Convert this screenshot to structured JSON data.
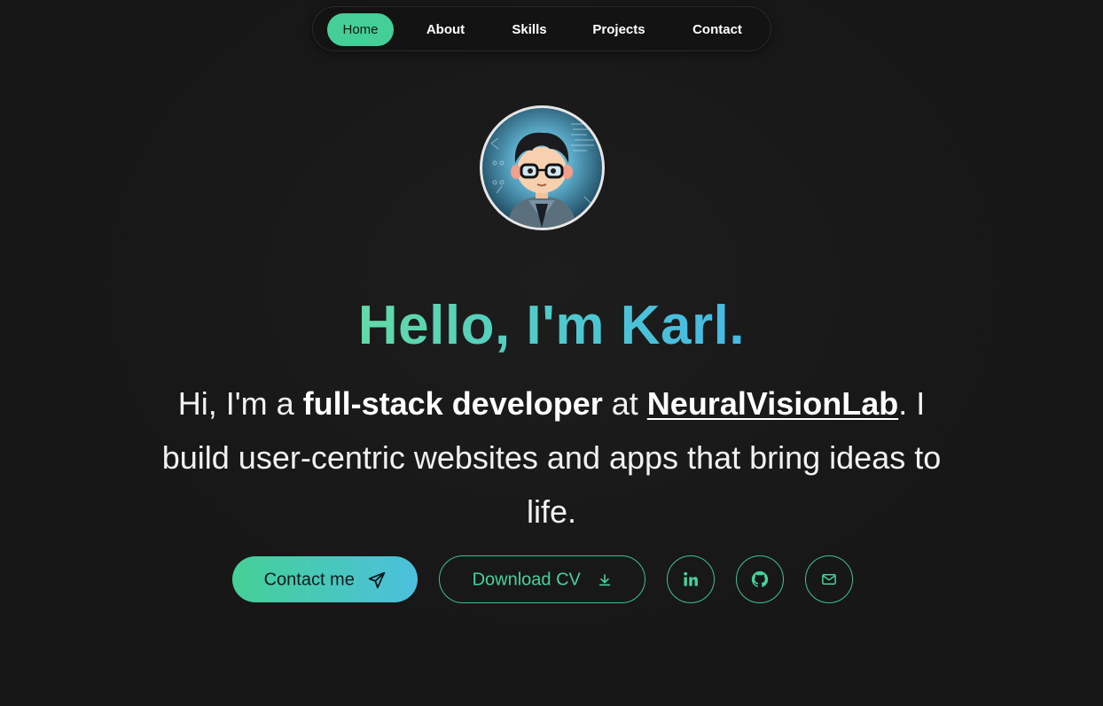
{
  "nav": {
    "items": [
      {
        "label": "Home",
        "active": true
      },
      {
        "label": "About",
        "active": false
      },
      {
        "label": "Skills",
        "active": false
      },
      {
        "label": "Projects",
        "active": false
      },
      {
        "label": "Contact",
        "active": false
      }
    ]
  },
  "hero": {
    "avatar_icon": "developer-avatar",
    "headline": "Hello, I'm Karl.",
    "intro": {
      "prefix": "Hi, I'm a ",
      "role": "full-stack developer",
      "middle": " at ",
      "company": "NeuralVisionLab",
      "suffix": ". I build user-centric websites and apps that bring ideas to life."
    }
  },
  "actions": {
    "contact_label": "Contact me",
    "contact_icon": "paper-plane-icon",
    "download_label": "Download CV",
    "download_icon": "download-icon"
  },
  "social": {
    "items": [
      {
        "icon": "linkedin-icon"
      },
      {
        "icon": "github-icon"
      },
      {
        "icon": "mail-icon"
      }
    ]
  },
  "colors": {
    "background": "#171717",
    "accent_green": "#44cf97",
    "accent_blue": "#45b9e6",
    "text": "#ffffff"
  }
}
